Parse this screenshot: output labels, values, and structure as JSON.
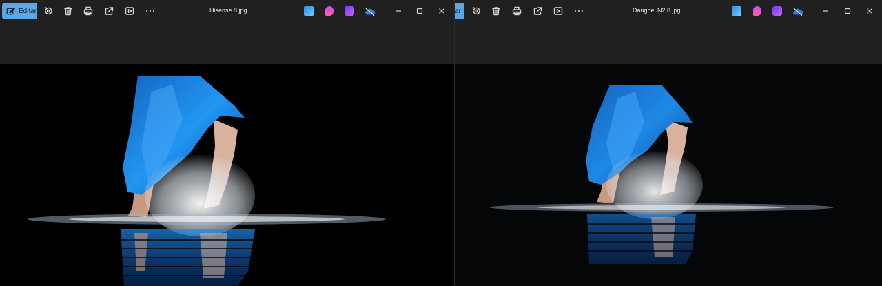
{
  "left_window": {
    "edit_label": "Editar",
    "file_name": "Hisense 8.jpg",
    "photo_alt": "Dancer in blue skirt splashing in water (Hisense)"
  },
  "right_window": {
    "edit_label_partial": "tar",
    "file_name": "Dangbei N2 8.jpg",
    "photo_alt": "Dancer in blue skirt splashing in water (Dangbei N2)"
  },
  "colors": {
    "accent": "#5aa6e8",
    "titlebar": "#202020",
    "image_bg": "#000000",
    "skirt_blue": "#1e88e5"
  },
  "icons": {
    "edit": "edit-icon",
    "rotate": "rotate-icon",
    "delete": "trash-icon",
    "print": "print-icon",
    "share": "share-icon",
    "slideshow": "slideshow-icon",
    "more": "more-icon",
    "photos_app": "photos-app-icon",
    "clipchamp": "clipchamp-icon",
    "designer": "designer-icon",
    "onedrive": "onedrive-icon",
    "minimize": "minimize-icon",
    "maximize": "maximize-icon",
    "close": "close-icon"
  }
}
